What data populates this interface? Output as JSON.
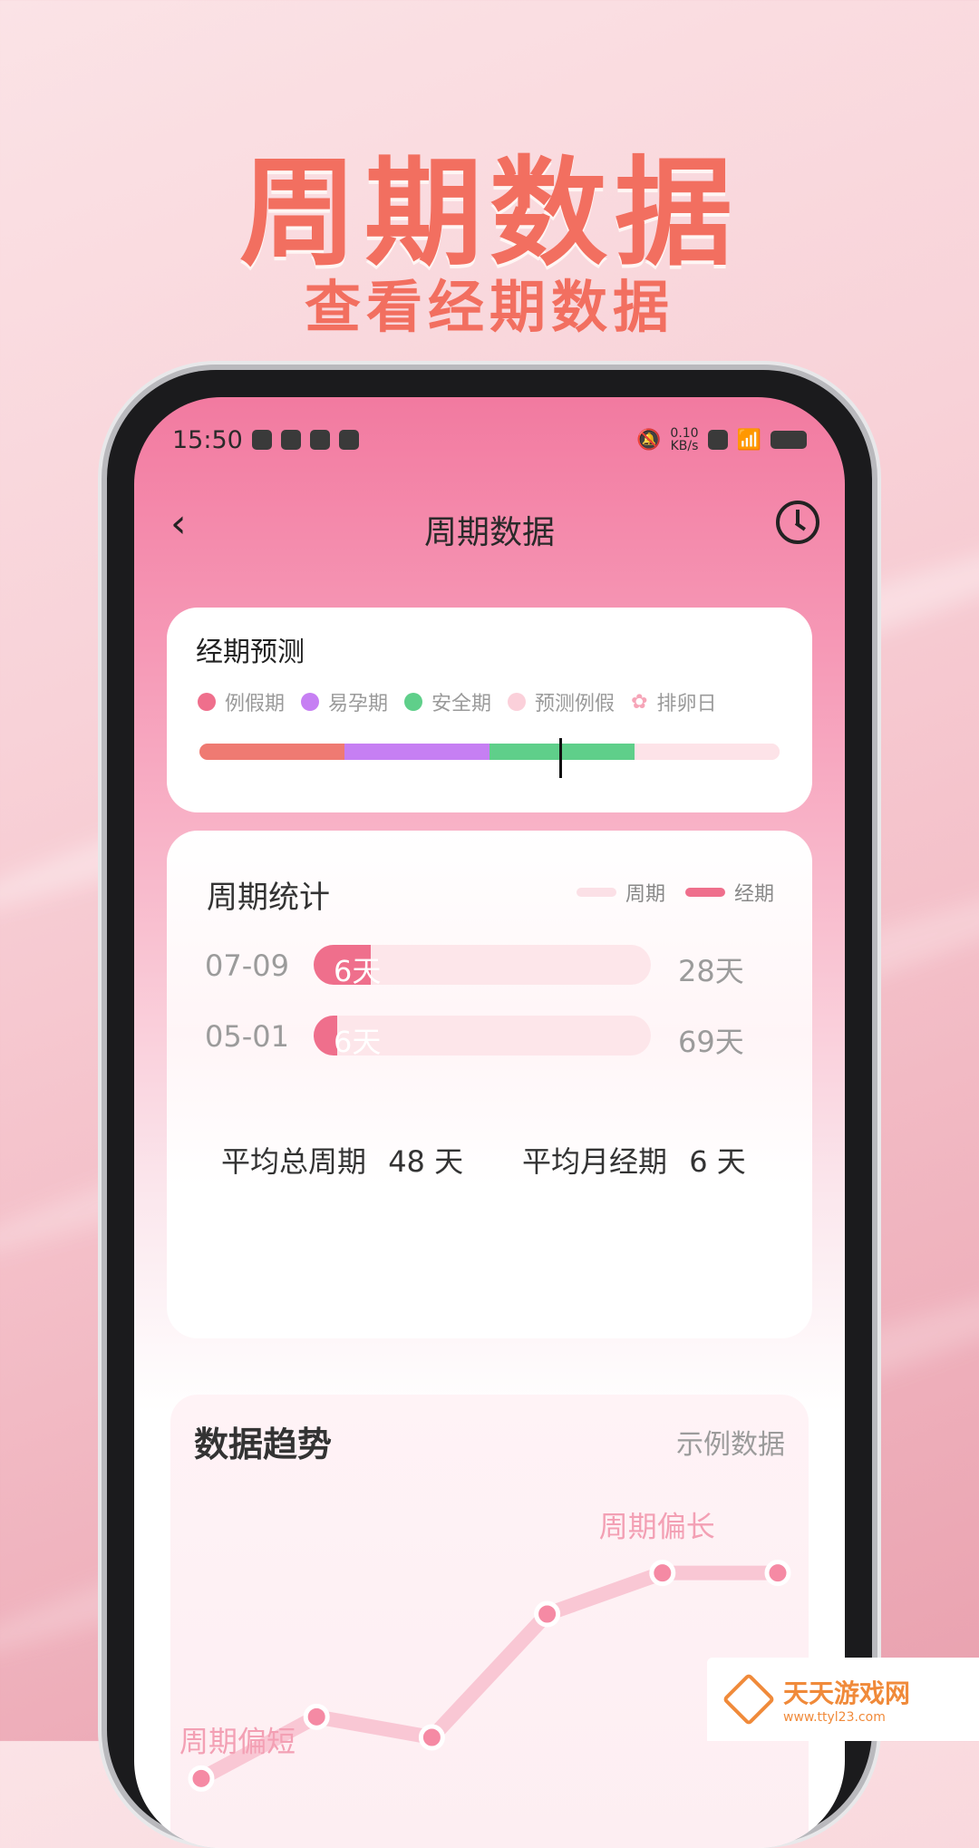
{
  "hero": {
    "title": "周期数据",
    "subtitle": "查看经期数据"
  },
  "status_bar": {
    "time": "15:50",
    "net_speed": "0.10",
    "net_unit": "KB/s"
  },
  "nav": {
    "title": "周期数据",
    "back_icon": "chevron-left-icon",
    "history_icon": "clock-icon"
  },
  "forecast": {
    "title": "经期预测",
    "legend": [
      {
        "label": "例假期",
        "color": "#ef6f8c"
      },
      {
        "label": "易孕期",
        "color": "#c67ff3"
      },
      {
        "label": "安全期",
        "color": "#5fcf8a"
      },
      {
        "label": "预测例假",
        "color": "#fbd0da"
      },
      {
        "label": "排卵日",
        "icon": "flower-icon"
      }
    ],
    "segments": [
      {
        "color": "#ef7a72",
        "fraction": 0.25
      },
      {
        "color": "#c67ff3",
        "fraction": 0.25
      },
      {
        "color": "#5fcf8a",
        "fraction": 0.25
      },
      {
        "color": "#fde3e8",
        "fraction": 0.25
      }
    ],
    "marker_fraction": 0.62
  },
  "cycle_stats": {
    "title": "周期统计",
    "legend": [
      {
        "label": "周期",
        "color": "#fbe0e6"
      },
      {
        "label": "经期",
        "color": "#ef6f8c"
      }
    ],
    "rows": [
      {
        "date": "07-09",
        "period_label": "6天",
        "cycle_label": "28天",
        "fill_fraction": 0.17
      },
      {
        "date": "05-01",
        "period_label": "6天",
        "cycle_label": "69天",
        "fill_fraction": 0.07
      }
    ],
    "avg_cycle_label": "平均总周期",
    "avg_cycle_value": "48 天",
    "avg_period_label": "平均月经期",
    "avg_period_value": "6 天"
  },
  "trend": {
    "title": "数据趋势",
    "sample_label": "示例数据",
    "annotation_long": "周期偏长",
    "annotation_short": "周期偏短"
  },
  "chart_data": {
    "type": "line",
    "title": "数据趋势",
    "x": [
      1,
      2,
      3,
      4,
      5,
      6
    ],
    "series": [
      {
        "values": [
          1.0,
          2.2,
          1.8,
          4.2,
          5.0,
          5.0
        ]
      }
    ],
    "annotations": [
      "周期偏长",
      "周期偏短"
    ],
    "ylim": [
      0,
      6
    ],
    "grid": false
  },
  "watermark": {
    "name": "天天游戏网",
    "url": "www.ttyl23.com"
  }
}
